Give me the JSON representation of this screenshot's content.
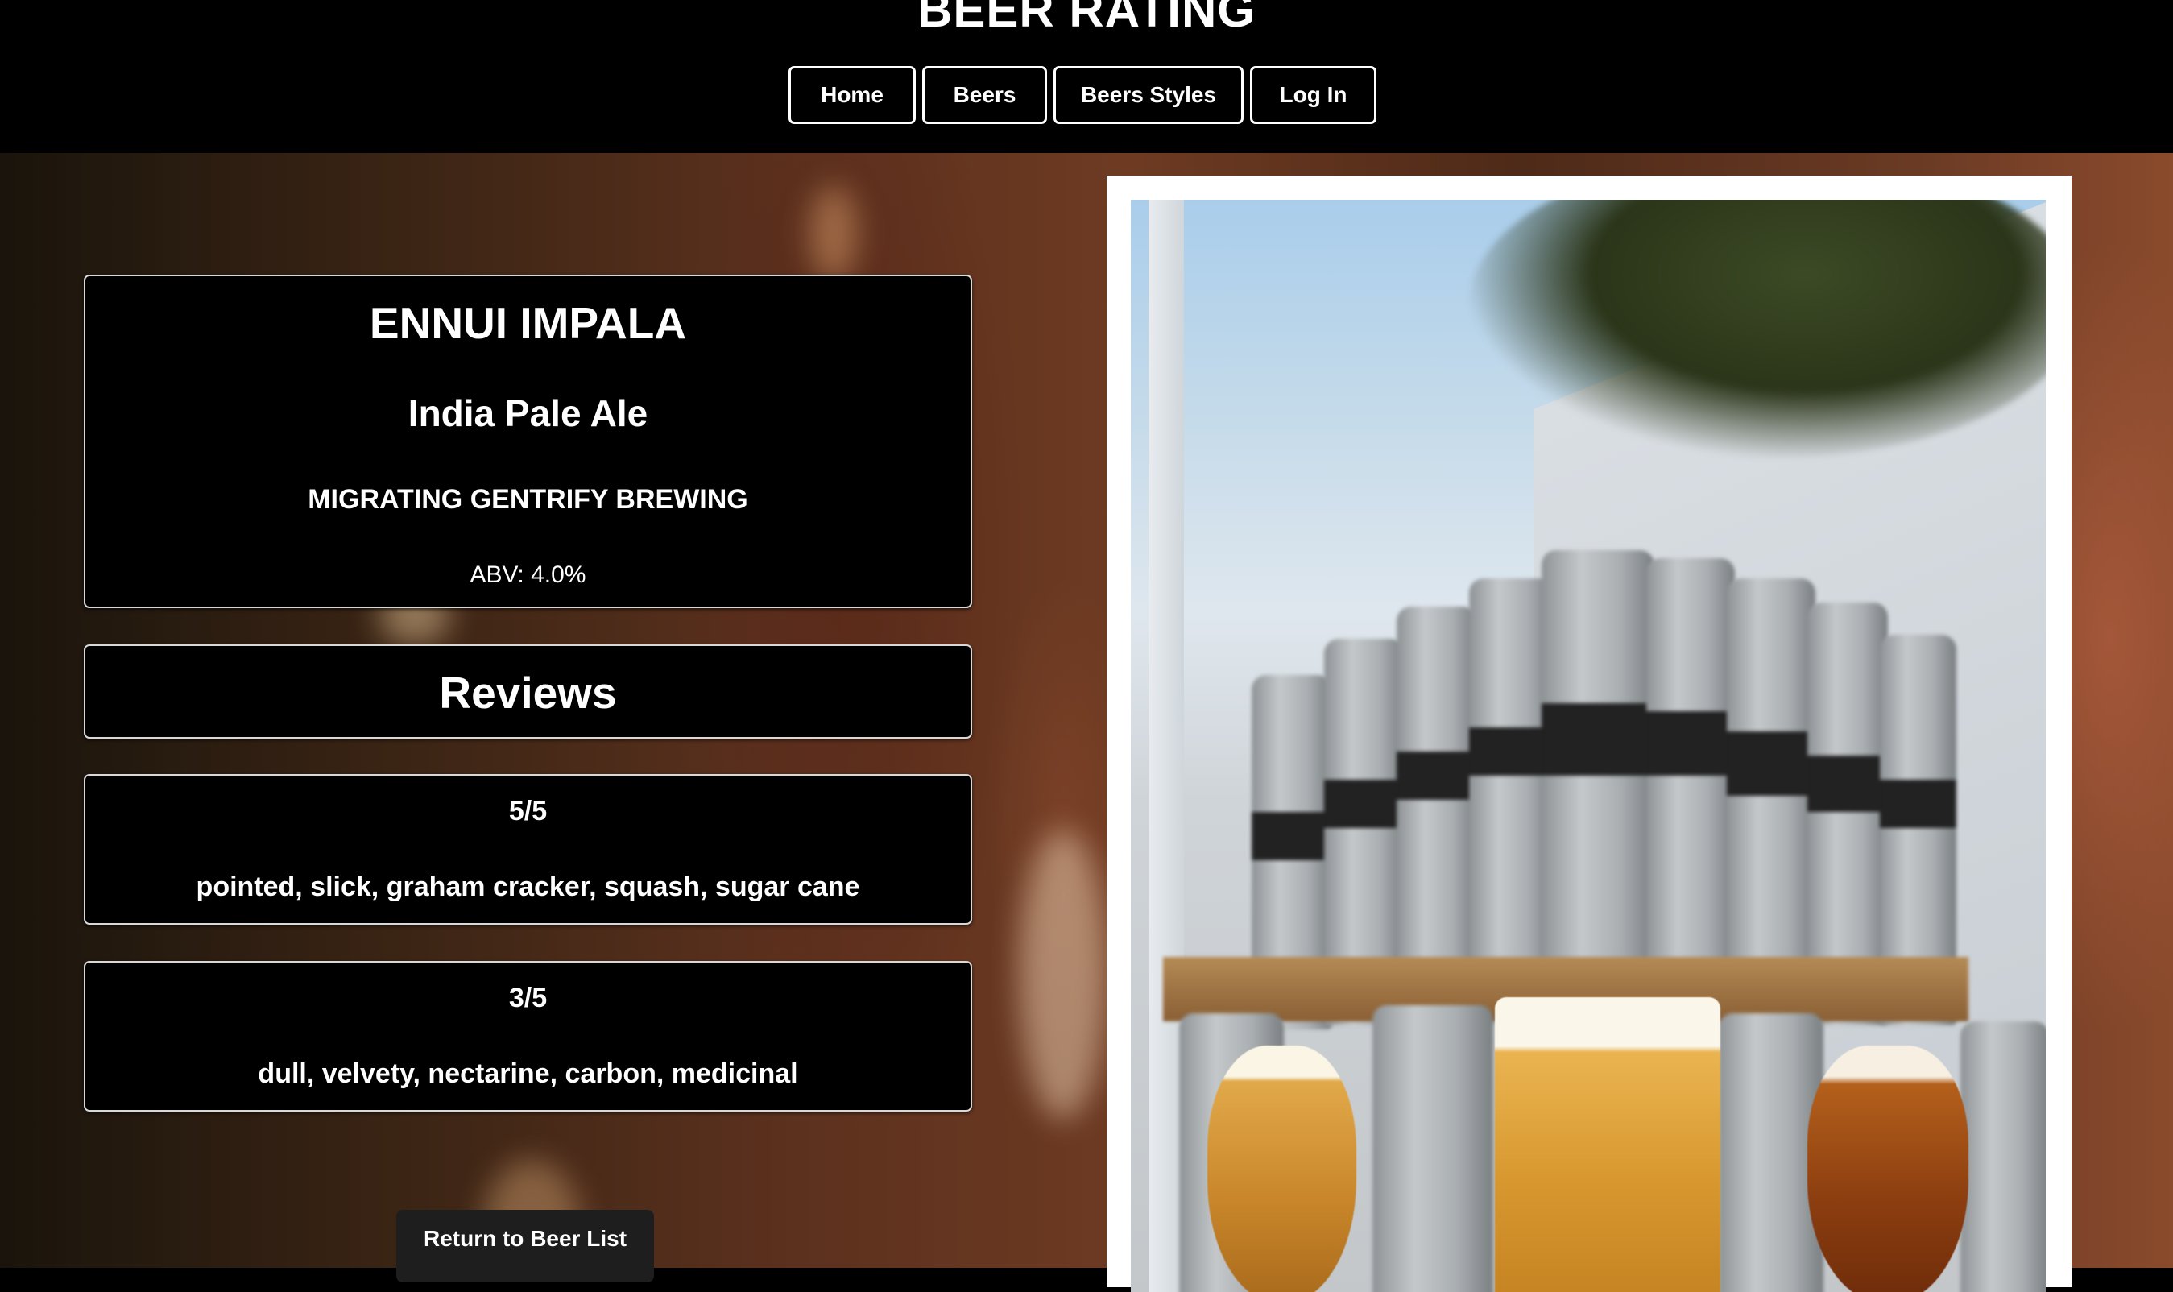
{
  "header": {
    "site_title": "BEER RATING",
    "nav": [
      {
        "label": "Home"
      },
      {
        "label": "Beers"
      },
      {
        "label": "Beers Styles"
      },
      {
        "label": "Log In"
      }
    ]
  },
  "beer": {
    "name": "ENNUI IMPALA",
    "style": "India Pale Ale",
    "brewery": "MIGRATING GENTRIFY BREWING",
    "abv": "ABV: 4.0%"
  },
  "reviews": {
    "heading": "Reviews",
    "items": [
      {
        "rating": "5/5",
        "notes": "pointed, slick, graham cracker, squash, sugar cane"
      },
      {
        "rating": "3/5",
        "notes": "dull, velvety, nectarine, carbon, medicinal"
      }
    ]
  },
  "actions": {
    "return_label": "Return to Beer List"
  },
  "colors": {
    "header_bg": "#000000",
    "card_bg": "#000000",
    "card_border": "#d8d8d8",
    "text": "#ffffff",
    "return_button_bg": "#1e1e1e"
  }
}
